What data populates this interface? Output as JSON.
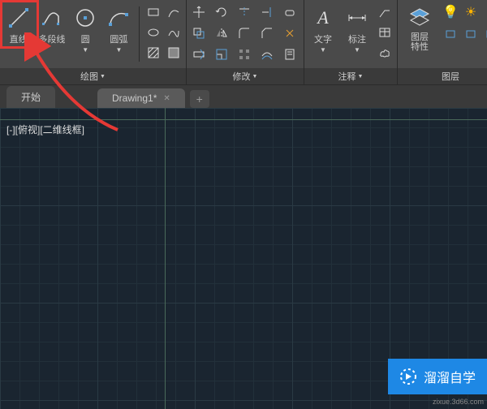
{
  "ribbon": {
    "draw": {
      "title": "绘图",
      "line": "直线",
      "polyline": "多段线",
      "circle": "圆",
      "arc": "圆弧"
    },
    "modify": {
      "title": "修改"
    },
    "annotate": {
      "title": "注释",
      "text": "文字",
      "dim": "标注"
    },
    "layers": {
      "title": "图层",
      "props": "图层\n特性"
    }
  },
  "tabs": {
    "start": "开始",
    "drawing": "Drawing1*"
  },
  "viewport": "[-][俯视][二维线框]",
  "watermark": {
    "text": "溜溜自学",
    "url": "zixue.3d66.com"
  }
}
